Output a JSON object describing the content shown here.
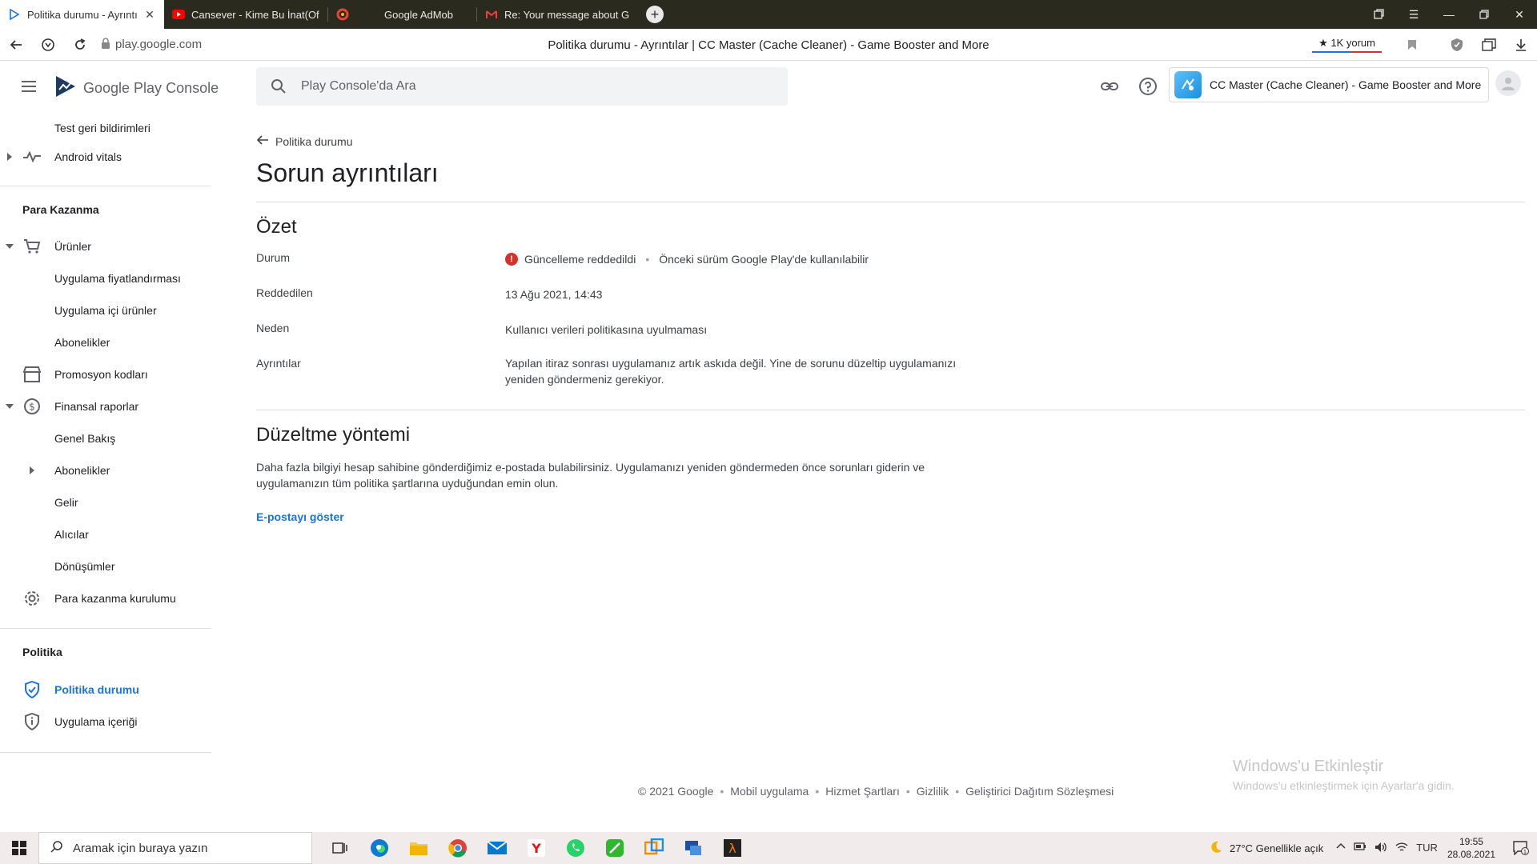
{
  "browser": {
    "tabs": [
      {
        "label": "Politika durumu - Ayrıntı",
        "active": true,
        "icon": "play-console-icon"
      },
      {
        "label": "Cansever - Kime Bu İnat(Of",
        "active": false,
        "icon": "youtube-icon"
      },
      {
        "label": "",
        "active": false,
        "icon": "admob-icon"
      },
      {
        "label": "Google AdMob",
        "active": false,
        "icon": "none"
      },
      {
        "label": "Re: Your message about G",
        "active": false,
        "icon": "gmail-icon"
      }
    ],
    "url": "play.google.com",
    "page_title": "Politika durumu - Ayrıntılar | CC Master (Cache Cleaner) - Game Booster and More",
    "review_badge": "★ 1K yorum"
  },
  "console": {
    "logo_text_1": "Google Play",
    "logo_text_2": "Console",
    "search_placeholder": "Play Console'da Ara",
    "app_name": "CC Master (Cache Cleaner) - Game Booster and More"
  },
  "sidebar": {
    "items_top": [
      {
        "label": "Test geri bildirimleri"
      },
      {
        "label": "Android vitals"
      }
    ],
    "section_monetize": "Para Kazanma",
    "monetize_items": [
      {
        "label": "Ürünler"
      },
      {
        "label": "Uygulama fiyatlandırması"
      },
      {
        "label": "Uygulama içi ürünler"
      },
      {
        "label": "Abonelikler"
      },
      {
        "label": "Promosyon kodları"
      },
      {
        "label": "Finansal raporlar"
      },
      {
        "label": "Genel Bakış"
      },
      {
        "label": "Abonelikler"
      },
      {
        "label": "Gelir"
      },
      {
        "label": "Alıcılar"
      },
      {
        "label": "Dönüşümler"
      },
      {
        "label": "Para kazanma kurulumu"
      }
    ],
    "section_policy": "Politika",
    "policy_items": [
      {
        "label": "Politika durumu"
      },
      {
        "label": "Uygulama içeriği"
      }
    ]
  },
  "main": {
    "back_label": "Politika durumu",
    "title": "Sorun ayrıntıları",
    "summary_heading": "Özet",
    "rows": {
      "status_label": "Durum",
      "status_value": "Güncelleme reddedildi",
      "status_extra": "Önceki sürüm Google Play'de kullanılabilir",
      "rejected_label": "Reddedilen",
      "rejected_value": "13 Ağu 2021, 14:43",
      "reason_label": "Neden",
      "reason_value": "Kullanıcı verileri politikasına uyulmaması",
      "details_label": "Ayrıntılar",
      "details_value_1": "Yapılan itiraz sonrası uygulamanız artık askıda değil. Yine de sorunu düzeltip uygulamanızı",
      "details_value_2": "yeniden göndermeniz gerekiyor."
    },
    "fix_heading": "Düzeltme yöntemi",
    "fix_text_1": "Daha fazla bilgiyi hesap sahibine gönderdiğimiz e-postada bulabilirsiniz. Uygulamanızı yeniden göndermeden önce sorunları giderin ve",
    "fix_text_2": "uygulamanızın tüm politika şartlarına uyduğundan emin olun.",
    "show_email_link": "E-postayı göster"
  },
  "footer": {
    "copyright": "© 2021 Google",
    "links": [
      "Mobil uygulama",
      "Hizmet Şartları",
      "Gizlilik",
      "Geliştirici Dağıtım Sözleşmesi"
    ]
  },
  "watermark": {
    "line1": "Windows'u Etkinleştir",
    "line2": "Windows'u etkinleştirmek için Ayarlar'a gidin."
  },
  "taskbar": {
    "search_placeholder": "Aramak için buraya yazın",
    "weather": "27°C  Genellikle açık",
    "language": "TUR",
    "time": "19:55",
    "date": "28.08.2021",
    "notification_count": "1"
  },
  "colors": {
    "accent": "#1a73e8",
    "error": "#d93025",
    "tabbar": "#2b2a1f",
    "taskbar": "#f1ebec"
  }
}
